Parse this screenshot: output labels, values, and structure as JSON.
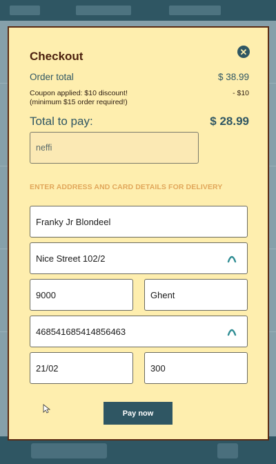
{
  "checkout": {
    "title": "Checkout",
    "order_total_label": "Order total",
    "order_total_value": "$ 38.99",
    "coupon_line1": "Coupon applied: $10 discount!",
    "coupon_line2": "(minimum $15 order required!)",
    "coupon_discount": "- $10",
    "total_label": "Total to pay:",
    "total_value": "$ 28.99",
    "coupon_code_value": "neffi"
  },
  "delivery": {
    "heading": "ENTER ADDRESS AND CARD DETAILS FOR DELIVERY",
    "name_value": "Franky Jr Blondeel",
    "street_value": "Nice Street 102/2",
    "postcode_value": "9000",
    "city_value": "Ghent",
    "card_number_value": "468541685414856463",
    "expiry_value": "21/02",
    "cvc_value": "300"
  },
  "actions": {
    "pay_label": "Pay now"
  },
  "icons": {
    "close": "close-icon",
    "autofill": "autofill-icon"
  },
  "colors": {
    "modal_bg": "#feeeae",
    "accent": "#2f5663",
    "heading_accent": "#e1a75a",
    "title": "#4a1f0d"
  }
}
